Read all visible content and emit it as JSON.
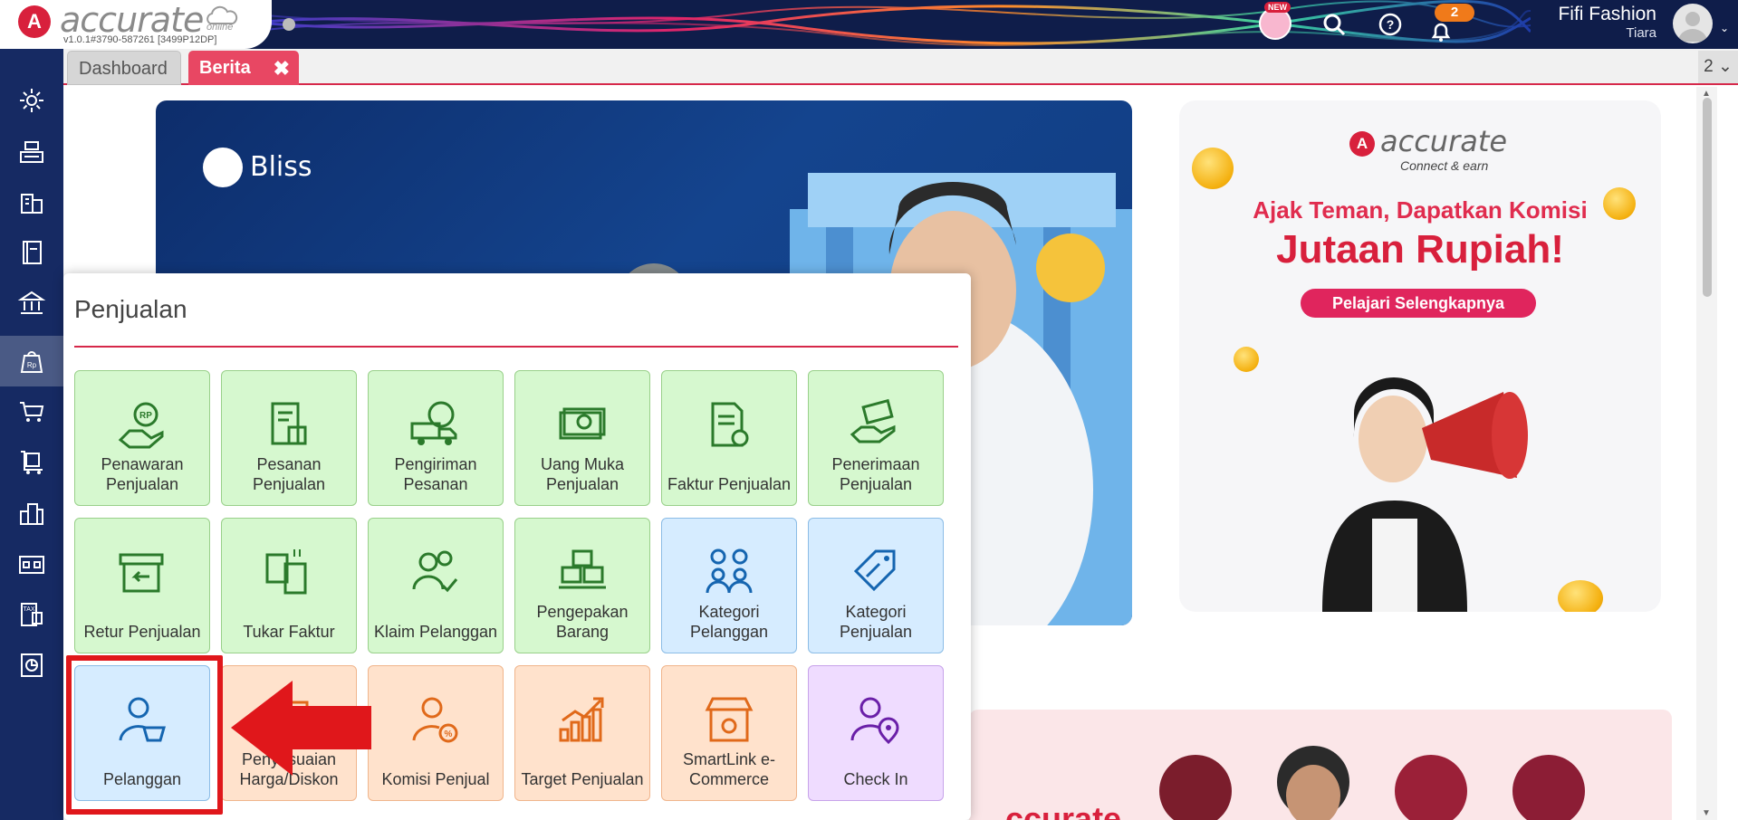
{
  "header": {
    "logo_text": "accurate",
    "logo_online": "online",
    "version": "v1.0.1#3790-587261 [3499P12DP]",
    "new_badge": "NEW",
    "notification_count": "2",
    "company_name": "Fifi Fashion",
    "user_name": "Tiara"
  },
  "sidebar": {
    "items": [
      "settings-icon",
      "cash-register-icon",
      "building-icon",
      "ledger-book-icon",
      "bank-icon",
      "sales-bag-icon",
      "cart-icon",
      "inventory-cart-icon",
      "city-icon",
      "warehouse-icon",
      "tax-icon",
      "report-chart-icon"
    ],
    "active_index": 5
  },
  "tabs": {
    "dashboard": "Dashboard",
    "berita": "Berita",
    "count": "2"
  },
  "banner_left": {
    "brand": "Bliss"
  },
  "banner_right": {
    "logo": "accurate",
    "tagline": "Connect & earn",
    "headline": "Ajak Teman, Dapatkan Komisi",
    "headline2": "Jutaan Rupiah!",
    "button": "Pelajari Selengkapnya"
  },
  "banner_bottom": {
    "text": "ccurate"
  },
  "popup": {
    "title": "Penjualan",
    "tiles": [
      {
        "label": "Penawaran Penjualan",
        "color": "green"
      },
      {
        "label": "Pesanan Penjualan",
        "color": "green"
      },
      {
        "label": "Pengiriman Pesanan",
        "color": "green"
      },
      {
        "label": "Uang Muka Penjualan",
        "color": "green"
      },
      {
        "label": "Faktur Penjualan",
        "color": "green"
      },
      {
        "label": "Penerimaan Penjualan",
        "color": "green"
      },
      {
        "label": "Retur Penjualan",
        "color": "green"
      },
      {
        "label": "Tukar Faktur",
        "color": "green"
      },
      {
        "label": "Klaim Pelanggan",
        "color": "green"
      },
      {
        "label": "Pengepakan Barang",
        "color": "green"
      },
      {
        "label": "Kategori Pelanggan",
        "color": "blue"
      },
      {
        "label": "Kategori Penjualan",
        "color": "blue"
      },
      {
        "label": "Pelanggan",
        "color": "blue"
      },
      {
        "label": "Penyesuaian Harga/Diskon",
        "color": "orange"
      },
      {
        "label": "Komisi Penjual",
        "color": "orange"
      },
      {
        "label": "Target Penjualan",
        "color": "orange"
      },
      {
        "label": "SmartLink e-Commerce",
        "color": "orange"
      },
      {
        "label": "Check In",
        "color": "purple"
      }
    ]
  },
  "colors": {
    "accent": "#d6284a",
    "nav": "#162a63",
    "annotation_red": "#e0171b"
  }
}
